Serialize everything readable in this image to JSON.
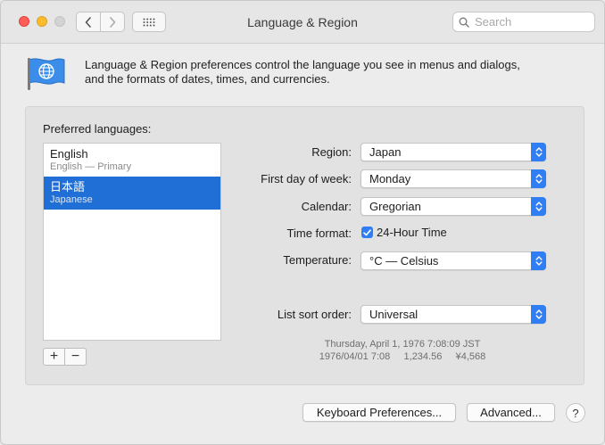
{
  "window": {
    "title": "Language & Region"
  },
  "toolbar": {
    "search_placeholder": "Search"
  },
  "header": {
    "description_line1": "Language & Region preferences control the language you see in menus and dialogs,",
    "description_line2": "and the formats of dates, times, and currencies."
  },
  "languages": {
    "label": "Preferred languages:",
    "items": [
      {
        "name": "English",
        "sub": "English — Primary",
        "selected": false
      },
      {
        "name": "日本語",
        "sub": "Japanese",
        "selected": true
      }
    ],
    "add_symbol": "+",
    "remove_symbol": "−"
  },
  "settings": {
    "region_label": "Region:",
    "region_value": "Japan",
    "first_day_label": "First day of week:",
    "first_day_value": "Monday",
    "calendar_label": "Calendar:",
    "calendar_value": "Gregorian",
    "time_format_label": "Time format:",
    "time_format_option": "24-Hour Time",
    "time_format_checked": true,
    "temperature_label": "Temperature:",
    "temperature_value": "°C — Celsius",
    "sort_order_label": "List sort order:",
    "sort_order_value": "Universal"
  },
  "sample": {
    "line1": "Thursday, April 1, 1976 7:08:09 JST",
    "line2": "1976/04/01 7:08     1,234.56     ¥4,568"
  },
  "buttons": {
    "keyboard": "Keyboard Preferences...",
    "advanced": "Advanced...",
    "help": "?"
  },
  "colors": {
    "accent": "#2f7ef3",
    "selection": "#1f6fd6",
    "close": "#fc5f57",
    "minimize": "#fdbc2e"
  }
}
